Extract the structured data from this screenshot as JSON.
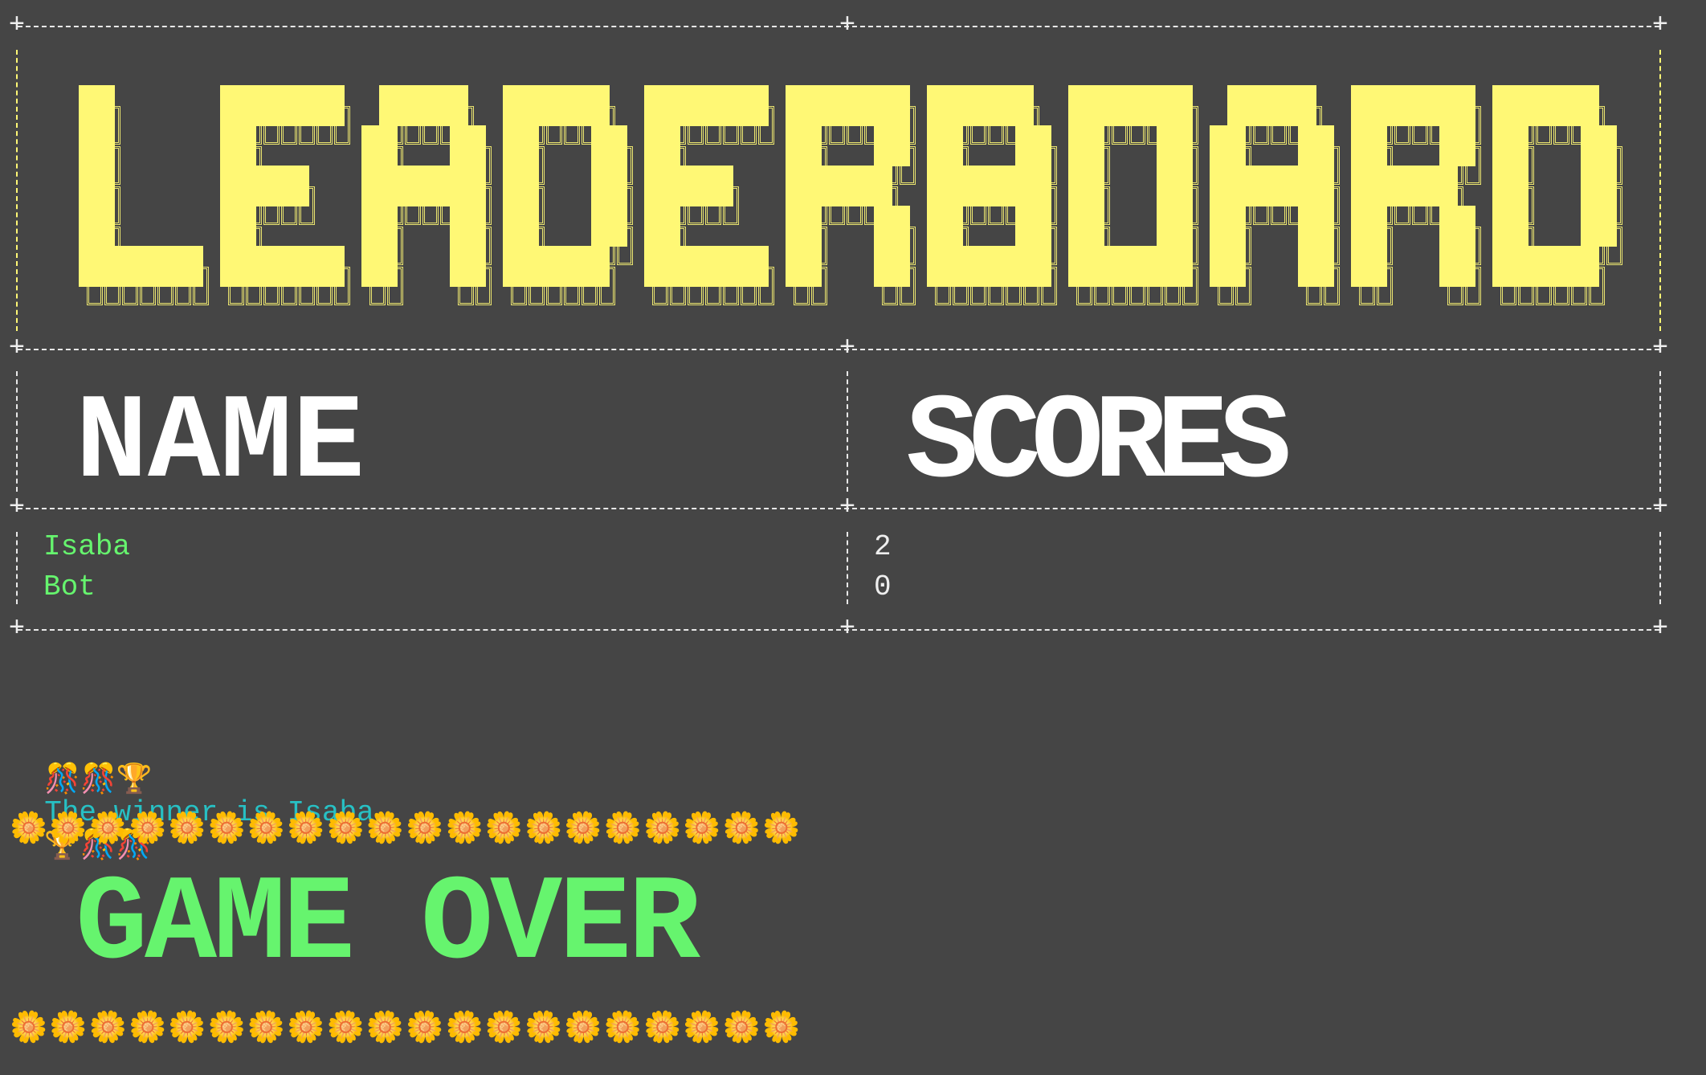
{
  "leaderboard": {
    "title": "LEADERBOARD",
    "columns": [
      "NAME",
      "SCORES"
    ],
    "rows": [
      {
        "name": "Isaba",
        "score": "2"
      },
      {
        "name": "Bot",
        "score": "0"
      }
    ]
  },
  "winner": {
    "prefix_icons": "🎊🎊🏆",
    "text": "The winner is Isaba",
    "suffix_icons": "🏆🎊🎊"
  },
  "flowers": "🌼🌼🌼🌼🌼🌼🌼🌼🌼🌼🌼🌼🌼🌼🌼🌼🌼🌼🌼🌼",
  "game_over": "GAME OVER",
  "colors": {
    "background": "#454545",
    "title": "#fff875",
    "header": "#ffffff",
    "name": "#66f46e",
    "winner": "#27c0c4",
    "game_over": "#66f46e"
  }
}
